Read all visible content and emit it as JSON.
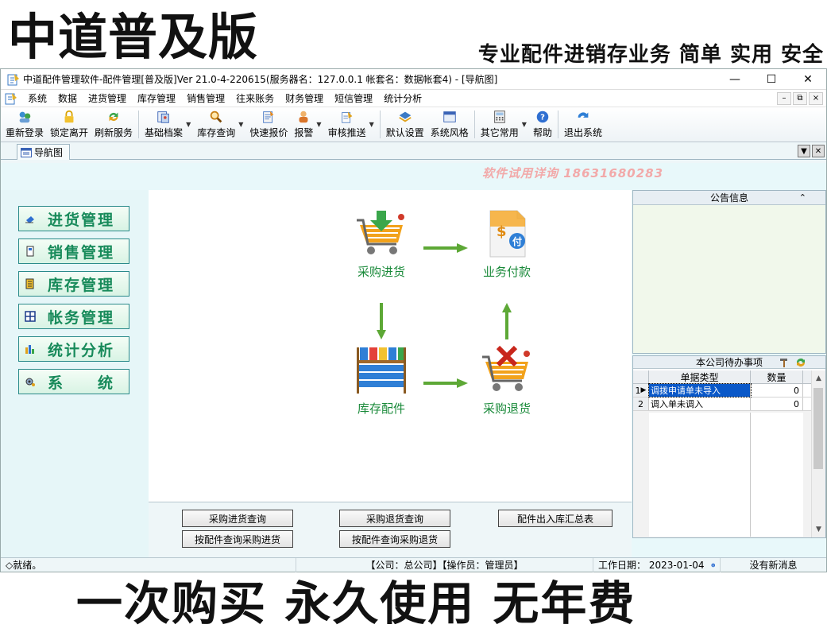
{
  "banner": {
    "title": "中道普及版",
    "slogan": "专业配件进销存业务  简单  实用  安全",
    "bottom_slogan": "一次购买  永久使用  无年费"
  },
  "window": {
    "title": "中道配件管理软件-配件管理[普及版]Ver 21.0-4-220615(服务器名：127.0.0.1 帐套名：数据帐套4) - [导航图]",
    "controls": {
      "minimize": "—",
      "maximize": "☐",
      "close": "✕"
    }
  },
  "menubar": {
    "items": [
      "系统",
      "数据",
      "进货管理",
      "库存管理",
      "销售管理",
      "往来账务",
      "财务管理",
      "短信管理",
      "统计分析"
    ],
    "mdi_controls": [
      "–",
      "⧉",
      "×"
    ]
  },
  "toolbar": {
    "buttons": [
      {
        "label": "重新登录",
        "icon": "relogin-icon"
      },
      {
        "label": "锁定离开",
        "icon": "lock-icon"
      },
      {
        "label": "刷新服务",
        "icon": "refresh-icon"
      },
      {
        "label": "基础档案",
        "icon": "archive-icon"
      },
      {
        "label": "库存查询",
        "icon": "inventory-search-icon"
      },
      {
        "label": "快速报价",
        "icon": "quote-icon"
      },
      {
        "label": "报警",
        "icon": "alarm-icon"
      },
      {
        "label": "审核推送",
        "icon": "audit-push-icon"
      },
      {
        "label": "默认设置",
        "icon": "default-settings-icon"
      },
      {
        "label": "系统风格",
        "icon": "style-icon"
      },
      {
        "label": "其它常用",
        "icon": "calculator-icon"
      },
      {
        "label": "帮助",
        "icon": "help-icon"
      },
      {
        "label": "退出系统",
        "icon": "exit-icon"
      }
    ]
  },
  "tab": {
    "label": "导航图"
  },
  "trial_notice": "软件试用详询 18631680283",
  "leftnav": {
    "items": [
      "进货管理",
      "销售管理",
      "库存管理",
      "帐务管理",
      "统计分析",
      "系　　统"
    ]
  },
  "flow": {
    "purchase_in": "采购进货",
    "payment": "业务付款",
    "stock_parts": "库存配件",
    "purchase_return": "采购退货"
  },
  "query_buttons": {
    "purchase_in_query": "采购进货查询",
    "purchase_return_query": "采购退货查询",
    "parts_io_summary": "配件出入库汇总表",
    "purchase_in_by_part": "按配件查询采购进货",
    "purchase_return_by_part": "按配件查询采购退货"
  },
  "notice_panel": {
    "title": "公告信息",
    "collapse": "⌃"
  },
  "todo_panel": {
    "title": "本公司待办事项",
    "columns": [
      "单据类型",
      "数量"
    ],
    "rows": [
      {
        "idx": "1",
        "type": "调拨申请单未导入",
        "qty": "0"
      },
      {
        "idx": "2",
        "type": "调入单未调入",
        "qty": "0"
      }
    ]
  },
  "statusbar": {
    "ready": "◇就绪。",
    "company_operator": "【公司：总公司】【操作员：管理员】",
    "work_date": "工作日期：  2023-01-04",
    "messages": "没有新消息"
  }
}
